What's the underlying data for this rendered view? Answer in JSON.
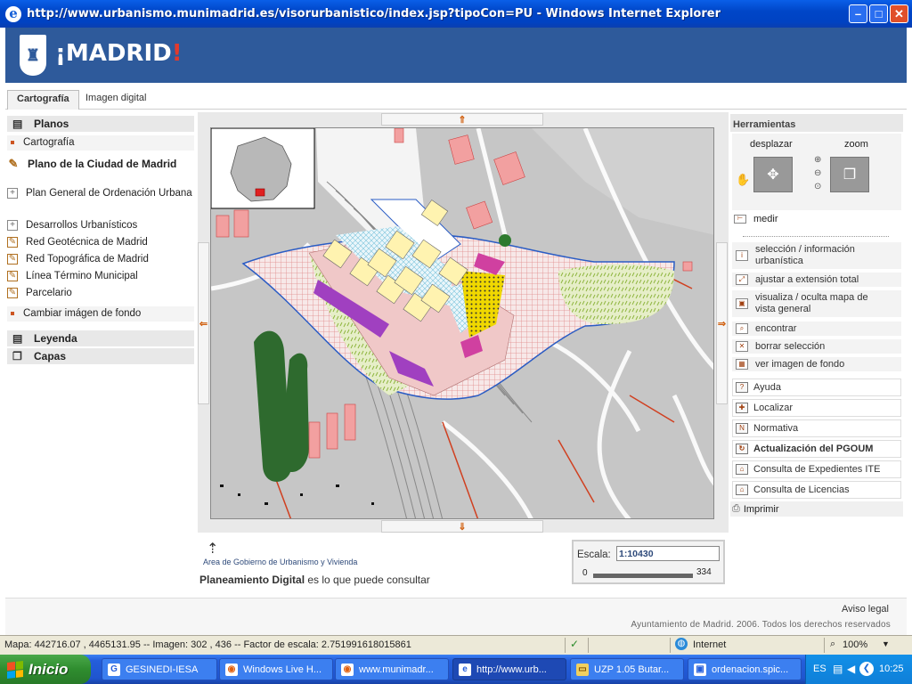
{
  "window": {
    "title": "http://www.urbanismo.munimadrid.es/visorurbanistico/index.jsp?tipoCon=PU - Windows Internet Explorer"
  },
  "header": {
    "logo_text": "¡MADRID!"
  },
  "tabs": [
    {
      "label": "Cartografía",
      "active": true
    },
    {
      "label": "Imagen digital",
      "active": false
    }
  ],
  "left": {
    "planos_label": "Planos",
    "cartografia_label": "Cartografía",
    "plano_ciudad_label": "Plano de la Ciudad de Madrid",
    "items": [
      {
        "label": "Plan General de Ordenación Urbana",
        "icon": "plus-box-icon"
      },
      {
        "label": "Desarrollos Urbanísticos",
        "icon": "plus-box-icon"
      },
      {
        "label": "Red Geotécnica de Madrid",
        "icon": "edit-icon"
      },
      {
        "label": "Red Topográfica de Madrid",
        "icon": "edit-icon"
      },
      {
        "label": "Línea Término Municipal",
        "icon": "edit-icon"
      },
      {
        "label": "Parcelario",
        "icon": "edit-icon"
      }
    ],
    "cambiar_fondo_label": "Cambiar imágen de fondo",
    "leyenda_label": "Leyenda",
    "capas_label": "Capas"
  },
  "map_info": {
    "credit": "Area de Gobierno de Urbanismo y Vivienda",
    "planeamiento_bold": "Planeamiento Digital",
    "planeamiento_rest": " es lo que puede consultar",
    "scale_label": "Escala:",
    "scale_value": "1:10430",
    "scalebar_min": "0",
    "scalebar_max": "334"
  },
  "tools": {
    "header": "Herramientas",
    "desplazar_label": "desplazar",
    "zoom_label": "zoom",
    "medir_label": "medir",
    "seleccion_label": "selección / información urbanística",
    "rows": [
      {
        "label": "ajustar a extensión total"
      },
      {
        "label": "visualiza / oculta mapa de vista general"
      },
      {
        "label": "encontrar"
      },
      {
        "label": "borrar selección"
      },
      {
        "label": "ver imagen de fondo"
      }
    ],
    "buttons": [
      {
        "label": "Ayuda",
        "bold": false
      },
      {
        "label": "Localizar",
        "bold": false
      },
      {
        "label": "Normativa",
        "bold": false
      },
      {
        "label": "Actualización del PGOUM",
        "bold": true
      },
      {
        "label": "Consulta de Expedientes ITE",
        "bold": false
      },
      {
        "label": "Consulta de Licencias",
        "bold": false
      }
    ],
    "imprimir_label": "Imprimir"
  },
  "footer": {
    "aviso_legal": "Aviso legal",
    "copyright": "Ayuntamiento de Madrid. 2006. Todos los derechos reservados"
  },
  "status": {
    "text": "Mapa: 442716.07 , 4465131.95 -- Imagen: 302 , 436 -- Factor de escala: 2.751991618015861",
    "zone": "Internet",
    "zoom": "100%"
  },
  "taskbar": {
    "start_label": "Inicio",
    "items": [
      {
        "label": "GESINEDI-IESA",
        "active": false
      },
      {
        "label": "Windows Live H...",
        "active": false
      },
      {
        "label": "www.munimadr...",
        "active": false
      },
      {
        "label": "http://www.urb...",
        "active": true
      },
      {
        "label": "UZP 1.05 Butar...",
        "active": false
      },
      {
        "label": "ordenacion.spic...",
        "active": false
      }
    ],
    "lang": "ES",
    "clock": "10:25"
  },
  "colors": {
    "header_bg": "#2e5a9b",
    "accent_red": "#e23a2c",
    "map_bg": "#c6c6c6",
    "map_boundary": "#2a5cc4"
  }
}
